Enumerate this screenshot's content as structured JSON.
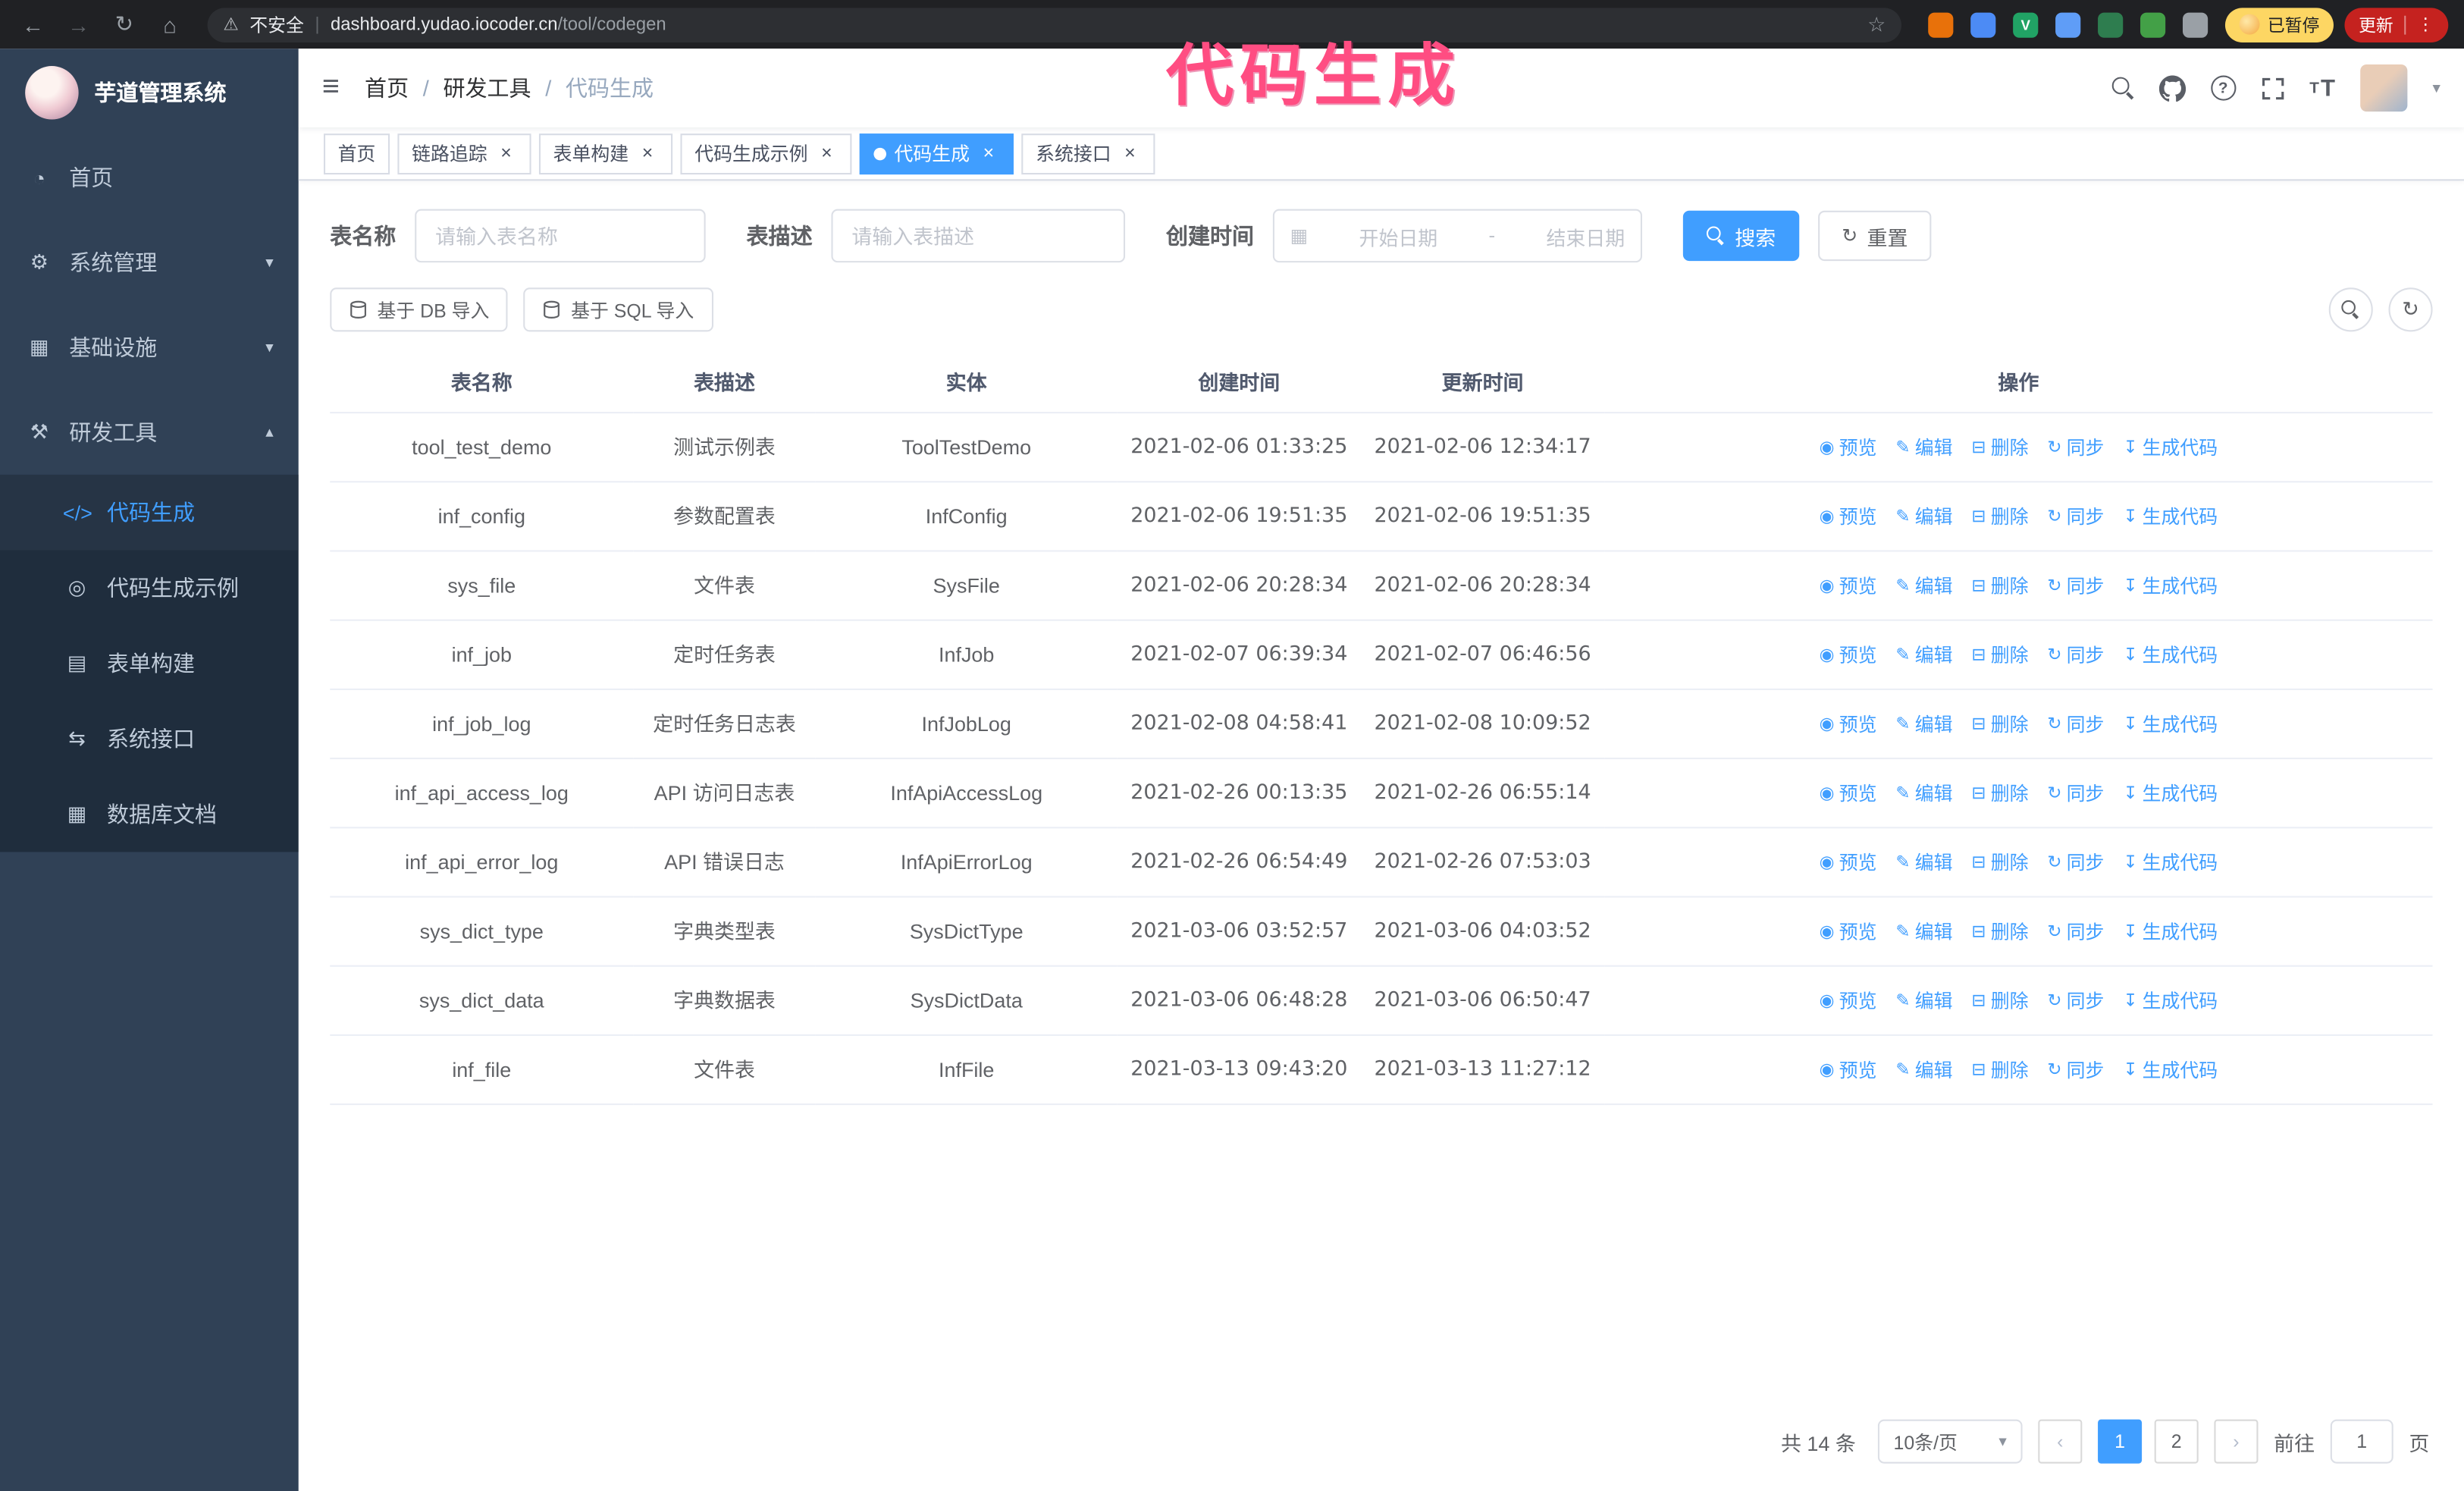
{
  "annotation": {
    "text": "代码生成"
  },
  "colors": {
    "accent": "#409eff",
    "sidebar": "#304156",
    "submenu": "#1f2d3d",
    "annotation": "#ff4d82",
    "active_tab": "#409eff"
  },
  "browser": {
    "security_label": "不安全",
    "url_domain": "dashboard.yudao.iocoder.cn",
    "url_path": "/tool/codegen",
    "paused_badge": "已暂停",
    "update_label": "更新",
    "extensions": [
      {
        "name": "extension-orange-icon",
        "color": "#e8710a",
        "glyph": ""
      },
      {
        "name": "extension-drop-icon",
        "color": "#4c8bf5",
        "glyph": ""
      },
      {
        "name": "extension-green-v-icon",
        "color": "#21a365",
        "glyph": "V"
      },
      {
        "name": "extension-people-icon",
        "color": "#5f9df7",
        "glyph": ""
      },
      {
        "name": "extension-table-icon",
        "color": "#2e7d4f",
        "glyph": ""
      },
      {
        "name": "extension-leaf-icon",
        "color": "#43a047",
        "glyph": ""
      },
      {
        "name": "extension-puzzle-icon",
        "color": "#9aa0a6",
        "glyph": ""
      }
    ]
  },
  "icons": {
    "back": "←",
    "forward": "→",
    "reload": "↻",
    "home": "⌂",
    "warning": "⚠",
    "star": "☆",
    "menu-dots": "⋮",
    "hamburger": "≡",
    "caret-down": "▾",
    "chevron-down": "▾",
    "chevron-up": "▴",
    "dashboard": "◔",
    "gear": "⚙",
    "infrastructure": "▦",
    "tools": "⚒",
    "code": "</>",
    "example": "◎",
    "form": "▤",
    "api": "⇆",
    "database": "▦",
    "eye": "◉",
    "edit": "✎",
    "delete": "⊟",
    "sync": "↻",
    "generate": "↧",
    "calendar": "▦",
    "refresh": "↻",
    "close": "×",
    "prev": "‹",
    "next": "›"
  },
  "sidebar": {
    "logo_title": "芋道管理系统",
    "items": [
      {
        "key": "home",
        "label": "首页",
        "icon": "dashboard"
      },
      {
        "key": "system",
        "label": "系统管理",
        "icon": "gear",
        "chevron": "down"
      },
      {
        "key": "infra",
        "label": "基础设施",
        "icon": "infrastructure",
        "chevron": "down"
      },
      {
        "key": "devtools",
        "label": "研发工具",
        "icon": "tools",
        "chevron": "up",
        "children": [
          {
            "key": "codegen",
            "label": "代码生成",
            "icon": "code",
            "active": true
          },
          {
            "key": "codegen-example",
            "label": "代码生成示例",
            "icon": "example"
          },
          {
            "key": "form-build",
            "label": "表单构建",
            "icon": "form"
          },
          {
            "key": "system-api",
            "label": "系统接口",
            "icon": "api"
          },
          {
            "key": "db-doc",
            "label": "数据库文档",
            "icon": "database"
          }
        ]
      }
    ]
  },
  "header": {
    "breadcrumb": [
      "首页",
      "研发工具",
      "代码生成"
    ]
  },
  "tabs": [
    {
      "key": "home",
      "label": "首页"
    },
    {
      "key": "tracer",
      "label": "链路追踪",
      "closable": true
    },
    {
      "key": "form-build",
      "label": "表单构建",
      "closable": true
    },
    {
      "key": "codegen-example",
      "label": "代码生成示例",
      "closable": true
    },
    {
      "key": "codegen",
      "label": "代码生成",
      "closable": true,
      "active": true
    },
    {
      "key": "system-api",
      "label": "系统接口",
      "closable": true
    }
  ],
  "filters": {
    "name_label": "表名称",
    "name_placeholder": "请输入表名称",
    "desc_label": "表描述",
    "desc_placeholder": "请输入表描述",
    "time_label": "创建时间",
    "start_placeholder": "开始日期",
    "range_separator": "-",
    "end_placeholder": "结束日期",
    "search_label": "搜索",
    "reset_label": "重置"
  },
  "toolbar": {
    "import_db_label": "基于 DB 导入",
    "import_sql_label": "基于 SQL 导入"
  },
  "table": {
    "columns": [
      "表名称",
      "表描述",
      "实体",
      "创建时间",
      "更新时间",
      "操作"
    ],
    "row_actions": [
      {
        "key": "preview",
        "label": "预览",
        "icon": "eye"
      },
      {
        "key": "edit",
        "label": "编辑",
        "icon": "edit"
      },
      {
        "key": "delete",
        "label": "删除",
        "icon": "delete"
      },
      {
        "key": "sync",
        "label": "同步",
        "icon": "sync"
      },
      {
        "key": "generate",
        "label": "生成代码",
        "icon": "generate"
      }
    ],
    "rows": [
      {
        "name": "tool_test_demo",
        "desc": "测试示例表",
        "entity": "ToolTestDemo",
        "created": "2021-02-06 01:33:25",
        "updated": "2021-02-06 12:34:17"
      },
      {
        "name": "inf_config",
        "desc": "参数配置表",
        "entity": "InfConfig",
        "created": "2021-02-06 19:51:35",
        "updated": "2021-02-06 19:51:35"
      },
      {
        "name": "sys_file",
        "desc": "文件表",
        "entity": "SysFile",
        "created": "2021-02-06 20:28:34",
        "updated": "2021-02-06 20:28:34"
      },
      {
        "name": "inf_job",
        "desc": "定时任务表",
        "entity": "InfJob",
        "created": "2021-02-07 06:39:34",
        "updated": "2021-02-07 06:46:56"
      },
      {
        "name": "inf_job_log",
        "desc": "定时任务日志表",
        "entity": "InfJobLog",
        "created": "2021-02-08 04:58:41",
        "updated": "2021-02-08 10:09:52"
      },
      {
        "name": "inf_api_access_log",
        "desc": "API 访问日志表",
        "entity": "InfApiAccessLog",
        "created": "2021-02-26 00:13:35",
        "updated": "2021-02-26 06:55:14"
      },
      {
        "name": "inf_api_error_log",
        "desc": "API 错误日志",
        "entity": "InfApiErrorLog",
        "created": "2021-02-26 06:54:49",
        "updated": "2021-02-26 07:53:03"
      },
      {
        "name": "sys_dict_type",
        "desc": "字典类型表",
        "entity": "SysDictType",
        "created": "2021-03-06 03:52:57",
        "updated": "2021-03-06 04:03:52"
      },
      {
        "name": "sys_dict_data",
        "desc": "字典数据表",
        "entity": "SysDictData",
        "created": "2021-03-06 06:48:28",
        "updated": "2021-03-06 06:50:47"
      },
      {
        "name": "inf_file",
        "desc": "文件表",
        "entity": "InfFile",
        "created": "2021-03-13 09:43:20",
        "updated": "2021-03-13 11:27:12"
      }
    ]
  },
  "pagination": {
    "total_label": "共 14 条",
    "page_size_label": "10条/页",
    "pages": [
      "1",
      "2"
    ],
    "active_page": "1",
    "goto_label": "前往",
    "goto_value": "1",
    "goto_suffix": "页"
  }
}
